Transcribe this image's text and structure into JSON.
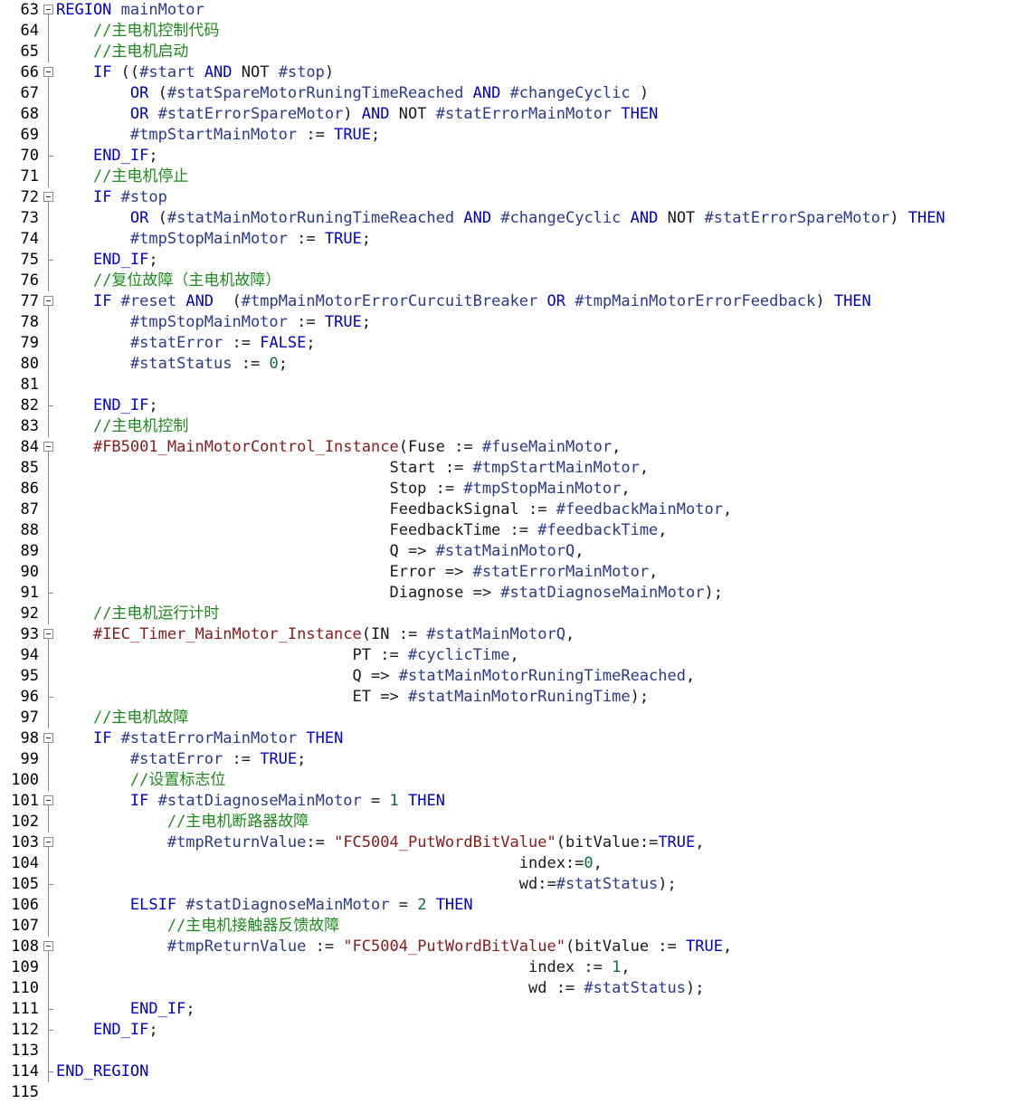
{
  "editor": {
    "colors": {
      "keyword": "#0000c8",
      "identifier": "#2a3a8c",
      "comment": "#1e8a1e",
      "string": "#8a1a1a",
      "number": "#0d6b3a",
      "line_number": "#000000"
    },
    "lines": [
      {
        "num": "63",
        "fold": "box",
        "indent": 0,
        "tokens": [
          {
            "t": "REGION",
            "k": "kw"
          },
          {
            "t": " mainMotor",
            "k": "id"
          }
        ]
      },
      {
        "num": "64",
        "fold": "line",
        "indent": 1,
        "tokens": [
          {
            "t": "//主电机控制代码",
            "k": "cm"
          }
        ]
      },
      {
        "num": "65",
        "fold": "line",
        "indent": 1,
        "tokens": [
          {
            "t": "//主电机启动",
            "k": "cm"
          }
        ]
      },
      {
        "num": "66",
        "fold": "box",
        "indent": 1,
        "tokens": [
          {
            "t": "IF",
            "k": "kw"
          },
          {
            "t": " ((",
            "k": "txt"
          },
          {
            "t": "#start",
            "k": "id"
          },
          {
            "t": " AND",
            "k": "kw"
          },
          {
            "t": " NOT ",
            "k": "txt"
          },
          {
            "t": "#stop",
            "k": "id"
          },
          {
            "t": ")",
            "k": "txt"
          }
        ]
      },
      {
        "num": "67",
        "fold": "line",
        "indent": 2,
        "tokens": [
          {
            "t": "OR",
            "k": "kw"
          },
          {
            "t": " (",
            "k": "txt"
          },
          {
            "t": "#statSpareMotorRuningTimeReached",
            "k": "id"
          },
          {
            "t": " AND",
            "k": "kw"
          },
          {
            "t": " #changeCyclic",
            "k": "id"
          },
          {
            "t": " )",
            "k": "txt"
          }
        ]
      },
      {
        "num": "68",
        "fold": "line",
        "indent": 2,
        "tokens": [
          {
            "t": "OR",
            "k": "kw"
          },
          {
            "t": " #statErrorSpareMotor",
            "k": "id"
          },
          {
            "t": ") ",
            "k": "txt"
          },
          {
            "t": "AND",
            "k": "kw"
          },
          {
            "t": " NOT ",
            "k": "txt"
          },
          {
            "t": "#statErrorMainMotor",
            "k": "id"
          },
          {
            "t": " THEN",
            "k": "kw"
          }
        ]
      },
      {
        "num": "69",
        "fold": "line",
        "indent": 2,
        "tokens": [
          {
            "t": "#tmpStartMainMotor",
            "k": "id"
          },
          {
            "t": " := ",
            "k": "txt"
          },
          {
            "t": "TRUE",
            "k": "kw"
          },
          {
            "t": ";",
            "k": "txt"
          }
        ]
      },
      {
        "num": "70",
        "fold": "end",
        "indent": 1,
        "tokens": [
          {
            "t": "END_IF",
            "k": "kw"
          },
          {
            "t": ";",
            "k": "txt"
          }
        ]
      },
      {
        "num": "71",
        "fold": "line",
        "indent": 1,
        "tokens": [
          {
            "t": "//主电机停止",
            "k": "cm"
          }
        ]
      },
      {
        "num": "72",
        "fold": "box",
        "indent": 1,
        "tokens": [
          {
            "t": "IF",
            "k": "kw"
          },
          {
            "t": " #stop",
            "k": "id"
          }
        ]
      },
      {
        "num": "73",
        "fold": "line",
        "indent": 2,
        "tokens": [
          {
            "t": "OR",
            "k": "kw"
          },
          {
            "t": " (",
            "k": "txt"
          },
          {
            "t": "#statMainMotorRuningTimeReached",
            "k": "id"
          },
          {
            "t": " AND",
            "k": "kw"
          },
          {
            "t": " #changeCyclic",
            "k": "id"
          },
          {
            "t": " AND",
            "k": "kw"
          },
          {
            "t": " NOT ",
            "k": "txt"
          },
          {
            "t": "#statErrorSpareMotor",
            "k": "id"
          },
          {
            "t": ") ",
            "k": "txt"
          },
          {
            "t": "THEN",
            "k": "kw"
          }
        ]
      },
      {
        "num": "74",
        "fold": "line",
        "indent": 2,
        "tokens": [
          {
            "t": "#tmpStopMainMotor",
            "k": "id"
          },
          {
            "t": " := ",
            "k": "txt"
          },
          {
            "t": "TRUE",
            "k": "kw"
          },
          {
            "t": ";",
            "k": "txt"
          }
        ]
      },
      {
        "num": "75",
        "fold": "end",
        "indent": 1,
        "tokens": [
          {
            "t": "END_IF",
            "k": "kw"
          },
          {
            "t": ";",
            "k": "txt"
          }
        ]
      },
      {
        "num": "76",
        "fold": "line",
        "indent": 1,
        "tokens": [
          {
            "t": "//复位故障（主电机故障）",
            "k": "cm"
          }
        ]
      },
      {
        "num": "77",
        "fold": "box",
        "indent": 1,
        "tokens": [
          {
            "t": "IF",
            "k": "kw"
          },
          {
            "t": " #reset",
            "k": "id"
          },
          {
            "t": " AND",
            "k": "kw"
          },
          {
            "t": "  (",
            "k": "txt"
          },
          {
            "t": "#tmpMainMotorErrorCurcuitBreaker",
            "k": "id"
          },
          {
            "t": " OR",
            "k": "kw"
          },
          {
            "t": " #tmpMainMotorErrorFeedback",
            "k": "id"
          },
          {
            "t": ") ",
            "k": "txt"
          },
          {
            "t": "THEN",
            "k": "kw"
          }
        ]
      },
      {
        "num": "78",
        "fold": "line",
        "indent": 2,
        "tokens": [
          {
            "t": "#tmpStopMainMotor",
            "k": "id"
          },
          {
            "t": " := ",
            "k": "txt"
          },
          {
            "t": "TRUE",
            "k": "kw"
          },
          {
            "t": ";",
            "k": "txt"
          }
        ]
      },
      {
        "num": "79",
        "fold": "line",
        "indent": 2,
        "tokens": [
          {
            "t": "#statError",
            "k": "id"
          },
          {
            "t": " := ",
            "k": "txt"
          },
          {
            "t": "FALSE",
            "k": "kw"
          },
          {
            "t": ";",
            "k": "txt"
          }
        ]
      },
      {
        "num": "80",
        "fold": "line",
        "indent": 2,
        "tokens": [
          {
            "t": "#statStatus",
            "k": "id"
          },
          {
            "t": " := ",
            "k": "txt"
          },
          {
            "t": "0",
            "k": "num"
          },
          {
            "t": ";",
            "k": "txt"
          }
        ]
      },
      {
        "num": "81",
        "fold": "line",
        "indent": 0,
        "tokens": []
      },
      {
        "num": "82",
        "fold": "end",
        "indent": 1,
        "tokens": [
          {
            "t": "END_IF",
            "k": "kw"
          },
          {
            "t": ";",
            "k": "txt"
          }
        ]
      },
      {
        "num": "83",
        "fold": "line",
        "indent": 1,
        "tokens": [
          {
            "t": "//主电机控制",
            "k": "cm"
          }
        ]
      },
      {
        "num": "84",
        "fold": "box",
        "indent": 1,
        "tokens": [
          {
            "t": "#FB5001_MainMotorControl_Instance",
            "k": "fb"
          },
          {
            "t": "(Fuse := ",
            "k": "txt"
          },
          {
            "t": "#fuseMainMotor",
            "k": "id"
          },
          {
            "t": ",",
            "k": "txt"
          }
        ]
      },
      {
        "num": "85",
        "fold": "line",
        "pad": "                                    ",
        "tokens": [
          {
            "t": "Start := ",
            "k": "txt"
          },
          {
            "t": "#tmpStartMainMotor",
            "k": "id"
          },
          {
            "t": ",",
            "k": "txt"
          }
        ]
      },
      {
        "num": "86",
        "fold": "line",
        "pad": "                                    ",
        "tokens": [
          {
            "t": "Stop := ",
            "k": "txt"
          },
          {
            "t": "#tmpStopMainMotor",
            "k": "id"
          },
          {
            "t": ",",
            "k": "txt"
          }
        ]
      },
      {
        "num": "87",
        "fold": "line",
        "pad": "                                    ",
        "tokens": [
          {
            "t": "FeedbackSignal := ",
            "k": "txt"
          },
          {
            "t": "#feedbackMainMotor",
            "k": "id"
          },
          {
            "t": ",",
            "k": "txt"
          }
        ]
      },
      {
        "num": "88",
        "fold": "line",
        "pad": "                                    ",
        "tokens": [
          {
            "t": "FeedbackTime := ",
            "k": "txt"
          },
          {
            "t": "#feedbackTime",
            "k": "id"
          },
          {
            "t": ",",
            "k": "txt"
          }
        ]
      },
      {
        "num": "89",
        "fold": "line",
        "pad": "                                    ",
        "tokens": [
          {
            "t": "Q => ",
            "k": "txt"
          },
          {
            "t": "#statMainMotorQ",
            "k": "id"
          },
          {
            "t": ",",
            "k": "txt"
          }
        ]
      },
      {
        "num": "90",
        "fold": "line",
        "pad": "                                    ",
        "tokens": [
          {
            "t": "Error => ",
            "k": "txt"
          },
          {
            "t": "#statErrorMainMotor",
            "k": "id"
          },
          {
            "t": ",",
            "k": "txt"
          }
        ]
      },
      {
        "num": "91",
        "fold": "end",
        "pad": "                                    ",
        "tokens": [
          {
            "t": "Diagnose => ",
            "k": "txt"
          },
          {
            "t": "#statDiagnoseMainMotor",
            "k": "id"
          },
          {
            "t": ");",
            "k": "txt"
          }
        ]
      },
      {
        "num": "92",
        "fold": "line",
        "indent": 1,
        "tokens": [
          {
            "t": "//主电机运行计时",
            "k": "cm"
          }
        ]
      },
      {
        "num": "93",
        "fold": "box",
        "indent": 1,
        "tokens": [
          {
            "t": "#IEC_Timer_MainMotor_Instance",
            "k": "fb"
          },
          {
            "t": "(IN := ",
            "k": "txt"
          },
          {
            "t": "#statMainMotorQ",
            "k": "id"
          },
          {
            "t": ",",
            "k": "txt"
          }
        ]
      },
      {
        "num": "94",
        "fold": "line",
        "pad": "                                ",
        "tokens": [
          {
            "t": "PT := ",
            "k": "txt"
          },
          {
            "t": "#cyclicTime",
            "k": "id"
          },
          {
            "t": ",",
            "k": "txt"
          }
        ]
      },
      {
        "num": "95",
        "fold": "line",
        "pad": "                                ",
        "tokens": [
          {
            "t": "Q => ",
            "k": "txt"
          },
          {
            "t": "#statMainMotorRuningTimeReached",
            "k": "id"
          },
          {
            "t": ",",
            "k": "txt"
          }
        ]
      },
      {
        "num": "96",
        "fold": "end",
        "pad": "                                ",
        "tokens": [
          {
            "t": "ET => ",
            "k": "txt"
          },
          {
            "t": "#statMainMotorRuningTime",
            "k": "id"
          },
          {
            "t": ");",
            "k": "txt"
          }
        ]
      },
      {
        "num": "97",
        "fold": "line",
        "indent": 1,
        "tokens": [
          {
            "t": "//主电机故障",
            "k": "cm"
          }
        ]
      },
      {
        "num": "98",
        "fold": "box",
        "indent": 1,
        "tokens": [
          {
            "t": "IF",
            "k": "kw"
          },
          {
            "t": " #statErrorMainMotor",
            "k": "id"
          },
          {
            "t": " THEN",
            "k": "kw"
          }
        ]
      },
      {
        "num": "99",
        "fold": "line",
        "indent": 2,
        "tokens": [
          {
            "t": "#statError",
            "k": "id"
          },
          {
            "t": " := ",
            "k": "txt"
          },
          {
            "t": "TRUE",
            "k": "kw"
          },
          {
            "t": ";",
            "k": "txt"
          }
        ]
      },
      {
        "num": "100",
        "fold": "line",
        "indent": 2,
        "tokens": [
          {
            "t": "//设置标志位",
            "k": "cm"
          }
        ]
      },
      {
        "num": "101",
        "fold": "box",
        "indent": 2,
        "tokens": [
          {
            "t": "IF",
            "k": "kw"
          },
          {
            "t": " #statDiagnoseMainMotor",
            "k": "id"
          },
          {
            "t": " = ",
            "k": "txt"
          },
          {
            "t": "1",
            "k": "num"
          },
          {
            "t": " THEN",
            "k": "kw"
          }
        ]
      },
      {
        "num": "102",
        "fold": "line",
        "indent": 3,
        "tokens": [
          {
            "t": "//主电机断路器故障",
            "k": "cm"
          }
        ]
      },
      {
        "num": "103",
        "fold": "box",
        "indent": 3,
        "tokens": [
          {
            "t": "#tmpReturnValue",
            "k": "id"
          },
          {
            "t": ":= ",
            "k": "txt"
          },
          {
            "t": "\"FC5004_PutWordBitValue\"",
            "k": "str"
          },
          {
            "t": "(bitValue:=",
            "k": "txt"
          },
          {
            "t": "TRUE",
            "k": "kw"
          },
          {
            "t": ",",
            "k": "txt"
          }
        ]
      },
      {
        "num": "104",
        "fold": "line",
        "pad": "                                                  ",
        "tokens": [
          {
            "t": "index:=",
            "k": "txt"
          },
          {
            "t": "0",
            "k": "num"
          },
          {
            "t": ",",
            "k": "txt"
          }
        ]
      },
      {
        "num": "105",
        "fold": "end",
        "pad": "                                                  ",
        "tokens": [
          {
            "t": "wd:=",
            "k": "txt"
          },
          {
            "t": "#statStatus",
            "k": "id"
          },
          {
            "t": ");",
            "k": "txt"
          }
        ]
      },
      {
        "num": "106",
        "fold": "line",
        "indent": 2,
        "tokens": [
          {
            "t": "ELSIF",
            "k": "kw"
          },
          {
            "t": " #statDiagnoseMainMotor",
            "k": "id"
          },
          {
            "t": " = ",
            "k": "txt"
          },
          {
            "t": "2",
            "k": "num"
          },
          {
            "t": " THEN",
            "k": "kw"
          }
        ]
      },
      {
        "num": "107",
        "fold": "line",
        "indent": 3,
        "tokens": [
          {
            "t": "//主电机接触器反馈故障",
            "k": "cm"
          }
        ]
      },
      {
        "num": "108",
        "fold": "box",
        "indent": 3,
        "tokens": [
          {
            "t": "#tmpReturnValue",
            "k": "id"
          },
          {
            "t": " := ",
            "k": "txt"
          },
          {
            "t": "\"FC5004_PutWordBitValue\"",
            "k": "str"
          },
          {
            "t": "(bitValue := ",
            "k": "txt"
          },
          {
            "t": "TRUE",
            "k": "kw"
          },
          {
            "t": ",",
            "k": "txt"
          }
        ]
      },
      {
        "num": "109",
        "fold": "line",
        "pad": "                                                   ",
        "tokens": [
          {
            "t": "index := ",
            "k": "txt"
          },
          {
            "t": "1",
            "k": "num"
          },
          {
            "t": ",",
            "k": "txt"
          }
        ]
      },
      {
        "num": "110",
        "fold": "line",
        "pad": "                                                   ",
        "tokens": [
          {
            "t": "wd := ",
            "k": "txt"
          },
          {
            "t": "#statStatus",
            "k": "id"
          },
          {
            "t": ");",
            "k": "txt"
          }
        ]
      },
      {
        "num": "111",
        "fold": "end",
        "indent": 2,
        "tokens": [
          {
            "t": "END_IF",
            "k": "kw"
          },
          {
            "t": ";",
            "k": "txt"
          }
        ]
      },
      {
        "num": "112",
        "fold": "end",
        "indent": 1,
        "tokens": [
          {
            "t": "END_IF",
            "k": "kw"
          },
          {
            "t": ";",
            "k": "txt"
          }
        ]
      },
      {
        "num": "113",
        "fold": "line",
        "indent": 0,
        "tokens": []
      },
      {
        "num": "114",
        "fold": "end",
        "indent": 0,
        "tokens": [
          {
            "t": "END_REGION",
            "k": "kw"
          }
        ]
      },
      {
        "num": "115",
        "fold": "none",
        "indent": 0,
        "tokens": []
      }
    ]
  }
}
